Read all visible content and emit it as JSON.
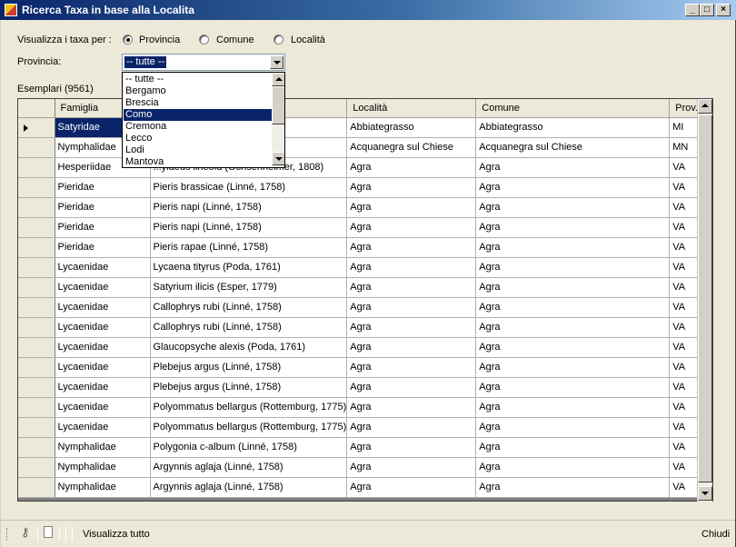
{
  "window": {
    "title": "Ricerca Taxa in base alla Localita"
  },
  "filters": {
    "visualizza_label": "Visualizza i taxa per :",
    "radios": [
      {
        "label": "Provincia",
        "checked": true
      },
      {
        "label": "Comune",
        "checked": false
      },
      {
        "label": "Località",
        "checked": false
      }
    ],
    "provincia_label": "Provincia:",
    "provincia_value": "-- tutte --",
    "esemplari_label": "Esemplari (9561)"
  },
  "dropdown": {
    "items": [
      "-- tutte --",
      "Bergamo",
      "Brescia",
      "Como",
      "Cremona",
      "Lecco",
      "Lodi",
      "Mantova"
    ],
    "highlighted": "Como"
  },
  "grid": {
    "columns": [
      "Famiglia",
      "",
      "Località",
      "Comune",
      "Prov."
    ],
    "rows": [
      [
        "Satyridae",
        "58)",
        "Abbiategrasso",
        "Abbiategrasso",
        "MI"
      ],
      [
        "Nymphalidae",
        "ller], 1775)",
        "Acquanegra sul Chiese",
        "Acquanegra sul Chiese",
        "MN"
      ],
      [
        "Hesperiidae",
        "...ylaeus lineola (Ochsenheimer, 1808)",
        "Agra",
        "Agra",
        "VA"
      ],
      [
        "Pieridae",
        "Pieris brassicae (Linné, 1758)",
        "Agra",
        "Agra",
        "VA"
      ],
      [
        "Pieridae",
        "Pieris napi (Linné, 1758)",
        "Agra",
        "Agra",
        "VA"
      ],
      [
        "Pieridae",
        "Pieris napi (Linné, 1758)",
        "Agra",
        "Agra",
        "VA"
      ],
      [
        "Pieridae",
        "Pieris rapae (Linné, 1758)",
        "Agra",
        "Agra",
        "VA"
      ],
      [
        "Lycaenidae",
        "Lycaena tityrus (Poda, 1761)",
        "Agra",
        "Agra",
        "VA"
      ],
      [
        "Lycaenidae",
        "Satyrium ilicis (Esper, 1779)",
        "Agra",
        "Agra",
        "VA"
      ],
      [
        "Lycaenidae",
        "Callophrys rubi (Linné, 1758)",
        "Agra",
        "Agra",
        "VA"
      ],
      [
        "Lycaenidae",
        "Callophrys rubi (Linné, 1758)",
        "Agra",
        "Agra",
        "VA"
      ],
      [
        "Lycaenidae",
        "Glaucopsyche alexis (Poda, 1761)",
        "Agra",
        "Agra",
        "VA"
      ],
      [
        "Lycaenidae",
        "Plebejus argus (Linné, 1758)",
        "Agra",
        "Agra",
        "VA"
      ],
      [
        "Lycaenidae",
        "Plebejus argus (Linné, 1758)",
        "Agra",
        "Agra",
        "VA"
      ],
      [
        "Lycaenidae",
        "Polyommatus bellargus (Rottemburg, 1775)",
        "Agra",
        "Agra",
        "VA"
      ],
      [
        "Lycaenidae",
        "Polyommatus bellargus (Rottemburg, 1775)",
        "Agra",
        "Agra",
        "VA"
      ],
      [
        "Nymphalidae",
        "Polygonia c-album (Linné, 1758)",
        "Agra",
        "Agra",
        "VA"
      ],
      [
        "Nymphalidae",
        "Argynnis aglaja (Linné, 1758)",
        "Agra",
        "Agra",
        "VA"
      ],
      [
        "Nymphalidae",
        "Argynnis aglaja (Linné, 1758)",
        "Agra",
        "Agra",
        "VA"
      ]
    ]
  },
  "statusbar": {
    "show_all_label": "Visualizza tutto",
    "close_label": "Chiudi"
  },
  "colors": {
    "title_start": "#0a246a",
    "selection": "#0a246a",
    "face": "#ece9d8"
  }
}
